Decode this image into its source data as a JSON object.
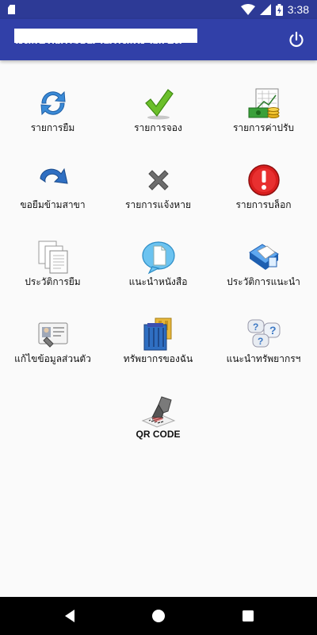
{
  "status_bar": {
    "time": "3:38",
    "icons": [
      "sd-card-icon",
      "wifi-icon",
      "cell-signal-icon",
      "battery-charging-icon"
    ]
  },
  "app_bar": {
    "title": "ห้องสมุดประชาชนจังหวัดเลย",
    "action_icon": "power-icon"
  },
  "menu": [
    {
      "id": "borrow-list",
      "label": "รายการยืม",
      "icon": "refresh-arrows-icon"
    },
    {
      "id": "reserve-list",
      "label": "รายการจอง",
      "icon": "checkmark-icon"
    },
    {
      "id": "fine-list",
      "label": "รายการค่าปรับ",
      "icon": "money-chart-icon"
    },
    {
      "id": "cross-branch",
      "label": "ขอยืมข้ามสาขา",
      "icon": "redo-arrow-icon"
    },
    {
      "id": "lost-report",
      "label": "รายการแจ้งหาย",
      "icon": "cross-mark-icon"
    },
    {
      "id": "block-list",
      "label": "รายการบล็อก",
      "icon": "alert-circle-icon"
    },
    {
      "id": "borrow-history",
      "label": "ประวัติการยืม",
      "icon": "documents-icon"
    },
    {
      "id": "recommend-book",
      "label": "แนะนำหนังสือ",
      "icon": "speech-bubble-document-icon"
    },
    {
      "id": "recommend-history",
      "label": "ประวัติการแนะนำ",
      "icon": "blue-folder-icon"
    },
    {
      "id": "edit-profile",
      "label": "แก้ไขข้อมูลส่วนตัว",
      "icon": "id-card-icon"
    },
    {
      "id": "my-resources",
      "label": "ทรัพยากรของฉัน",
      "icon": "bookshelf-icon"
    },
    {
      "id": "recommend-resource",
      "label": "แนะนำทรัพยากรฯ",
      "icon": "question-bubbles-icon"
    },
    {
      "id": "qr-code",
      "label": "QR CODE",
      "icon": "barcode-scanner-icon"
    }
  ],
  "colors": {
    "status_bar": "#2d3a96",
    "app_bar": "#3140a8",
    "background": "#fafafa",
    "nav_bar": "#000000"
  },
  "nav_bar": {
    "buttons": [
      "back-icon",
      "home-icon",
      "recents-icon"
    ]
  }
}
